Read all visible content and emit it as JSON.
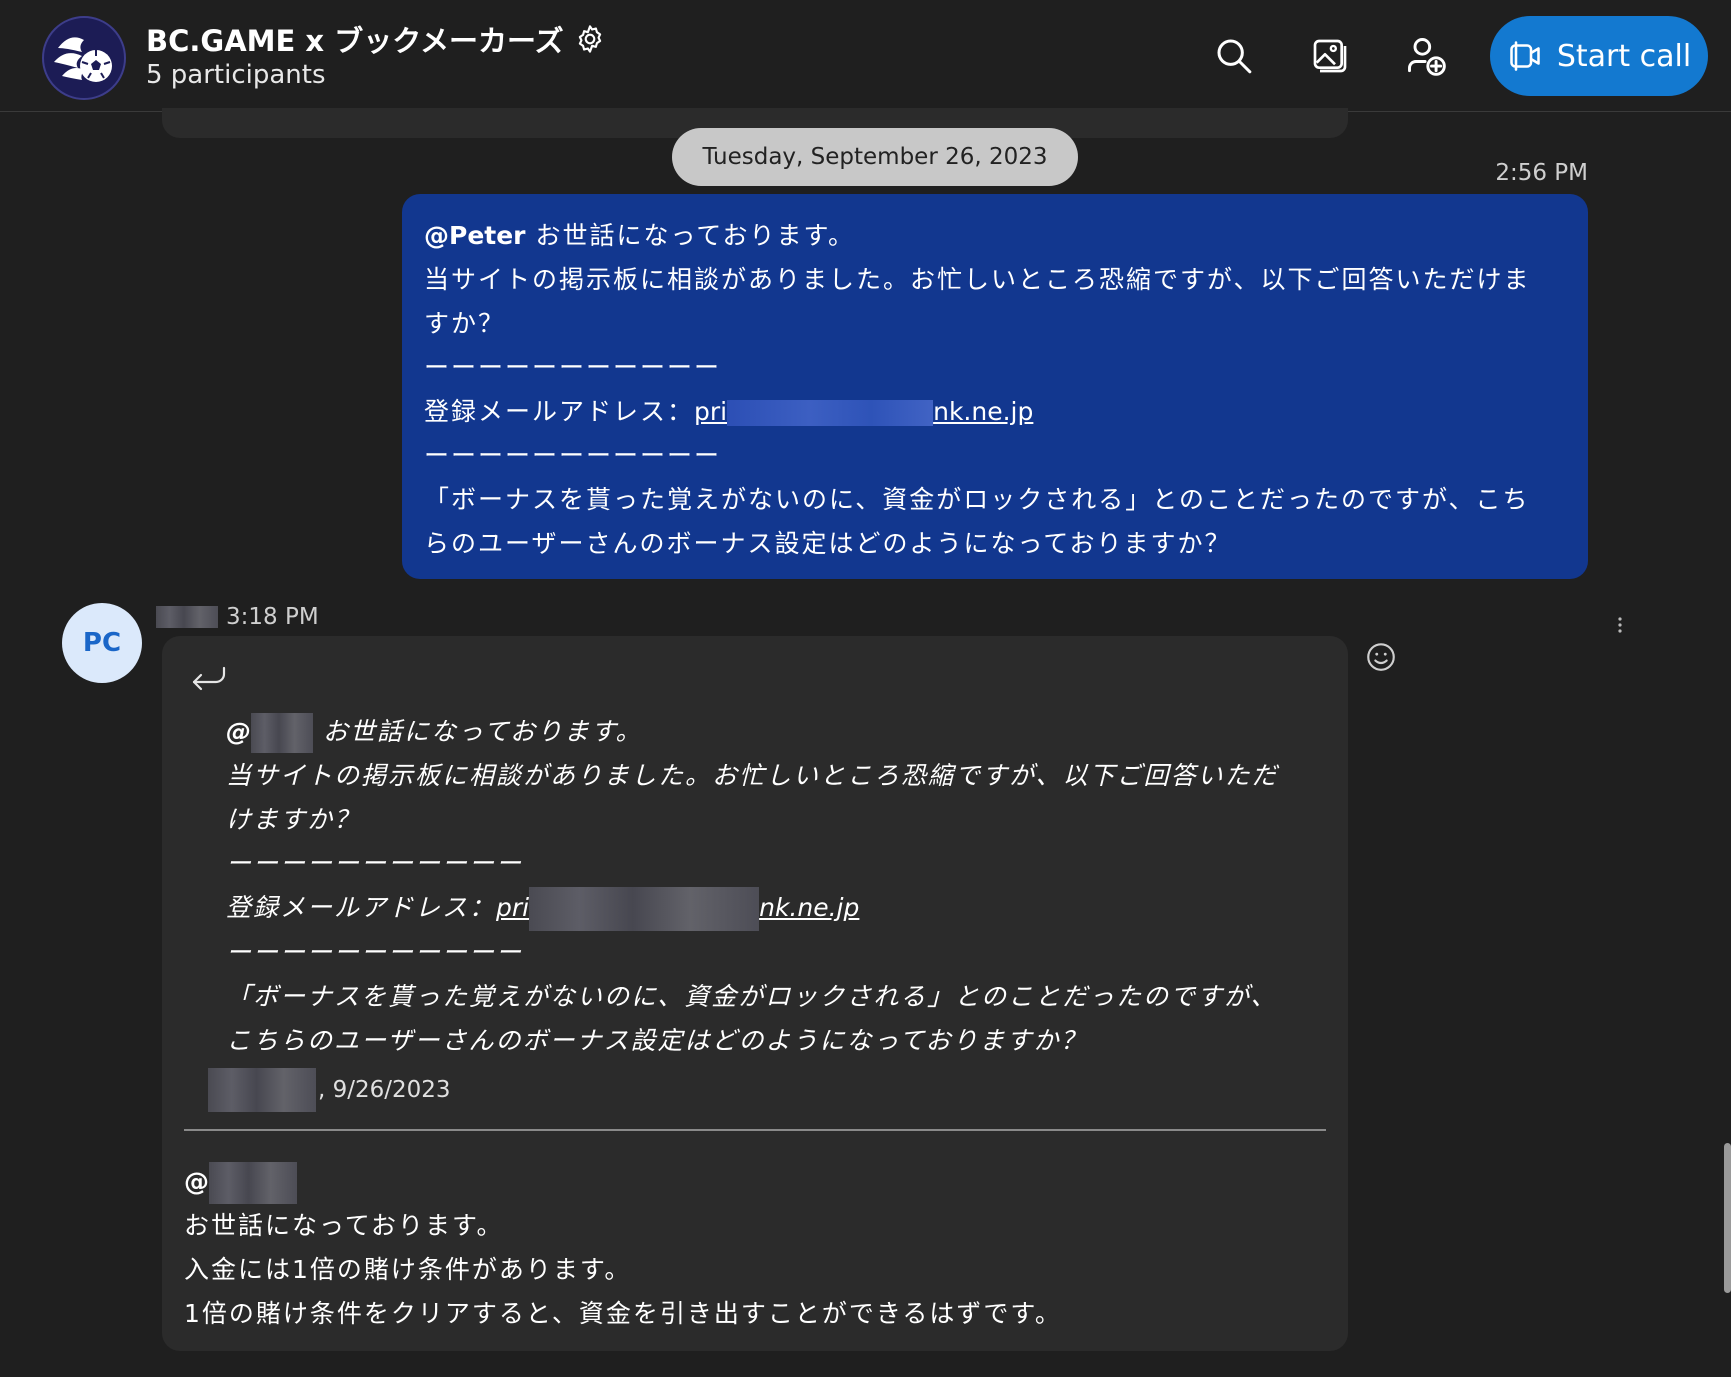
{
  "header": {
    "title": "BC.GAME x ブックメーカーズ",
    "participants": "5 participants",
    "start_call_label": "Start call"
  },
  "conversation": {
    "date_separator": "Tuesday, September 26, 2023",
    "own_message": {
      "time": "2:56 PM",
      "mention": "@Peter",
      "greeting": " お世話になっております。",
      "lines": [
        "当サイトの掲示板に相談がありました。お忙しいところ恐縮ですが、以下ご回答いただけま",
        "すか？",
        "ーーーーーーーーーーー"
      ],
      "email_label": "登録メールアドレス：",
      "email_start": "pri",
      "email_end": "nk.ne.jp",
      "lines_after": [
        "ーーーーーーーーーーー",
        "「ボーナスを貰った覚えがないのに、資金がロックされる」とのことだったのですが、こち",
        "らのユーザーさんのボーナス設定はどのようになっておりますか？"
      ]
    },
    "reply_message": {
      "avatar_initials": "PC",
      "time": "3:18 PM",
      "quote": {
        "mention_prefix": "@",
        "greeting": " お世話になっております。",
        "lines": [
          "当サイトの掲示板に相談がありました。お忙しいところ恐縮ですが、以下ご回答いただ",
          "けますか？",
          "ーーーーーーーーーーー"
        ],
        "email_label": "登録メールアドレス：",
        "email_start": "pri",
        "email_end": "nk.ne.jp",
        "lines_after": [
          "ーーーーーーーーーーー",
          "「ボーナスを貰った覚えがないのに、資金がロックされる」とのことだったのですが、",
          "こちらのユーザーさんのボーナス設定はどのようになっておりますか？"
        ],
        "meta_date": ", 9/26/2023"
      },
      "body": {
        "mention_prefix": "@",
        "lines": [
          "お世話になっております。",
          "入金には1倍の賭け条件があります。",
          "1倍の賭け条件をクリアすると、資金を引き出すことができるはずです。"
        ]
      }
    }
  },
  "colors": {
    "background": "#1f1f1f",
    "own_bubble": "#12378f",
    "other_bubble": "#2b2b2b",
    "accent": "#1379d0"
  }
}
